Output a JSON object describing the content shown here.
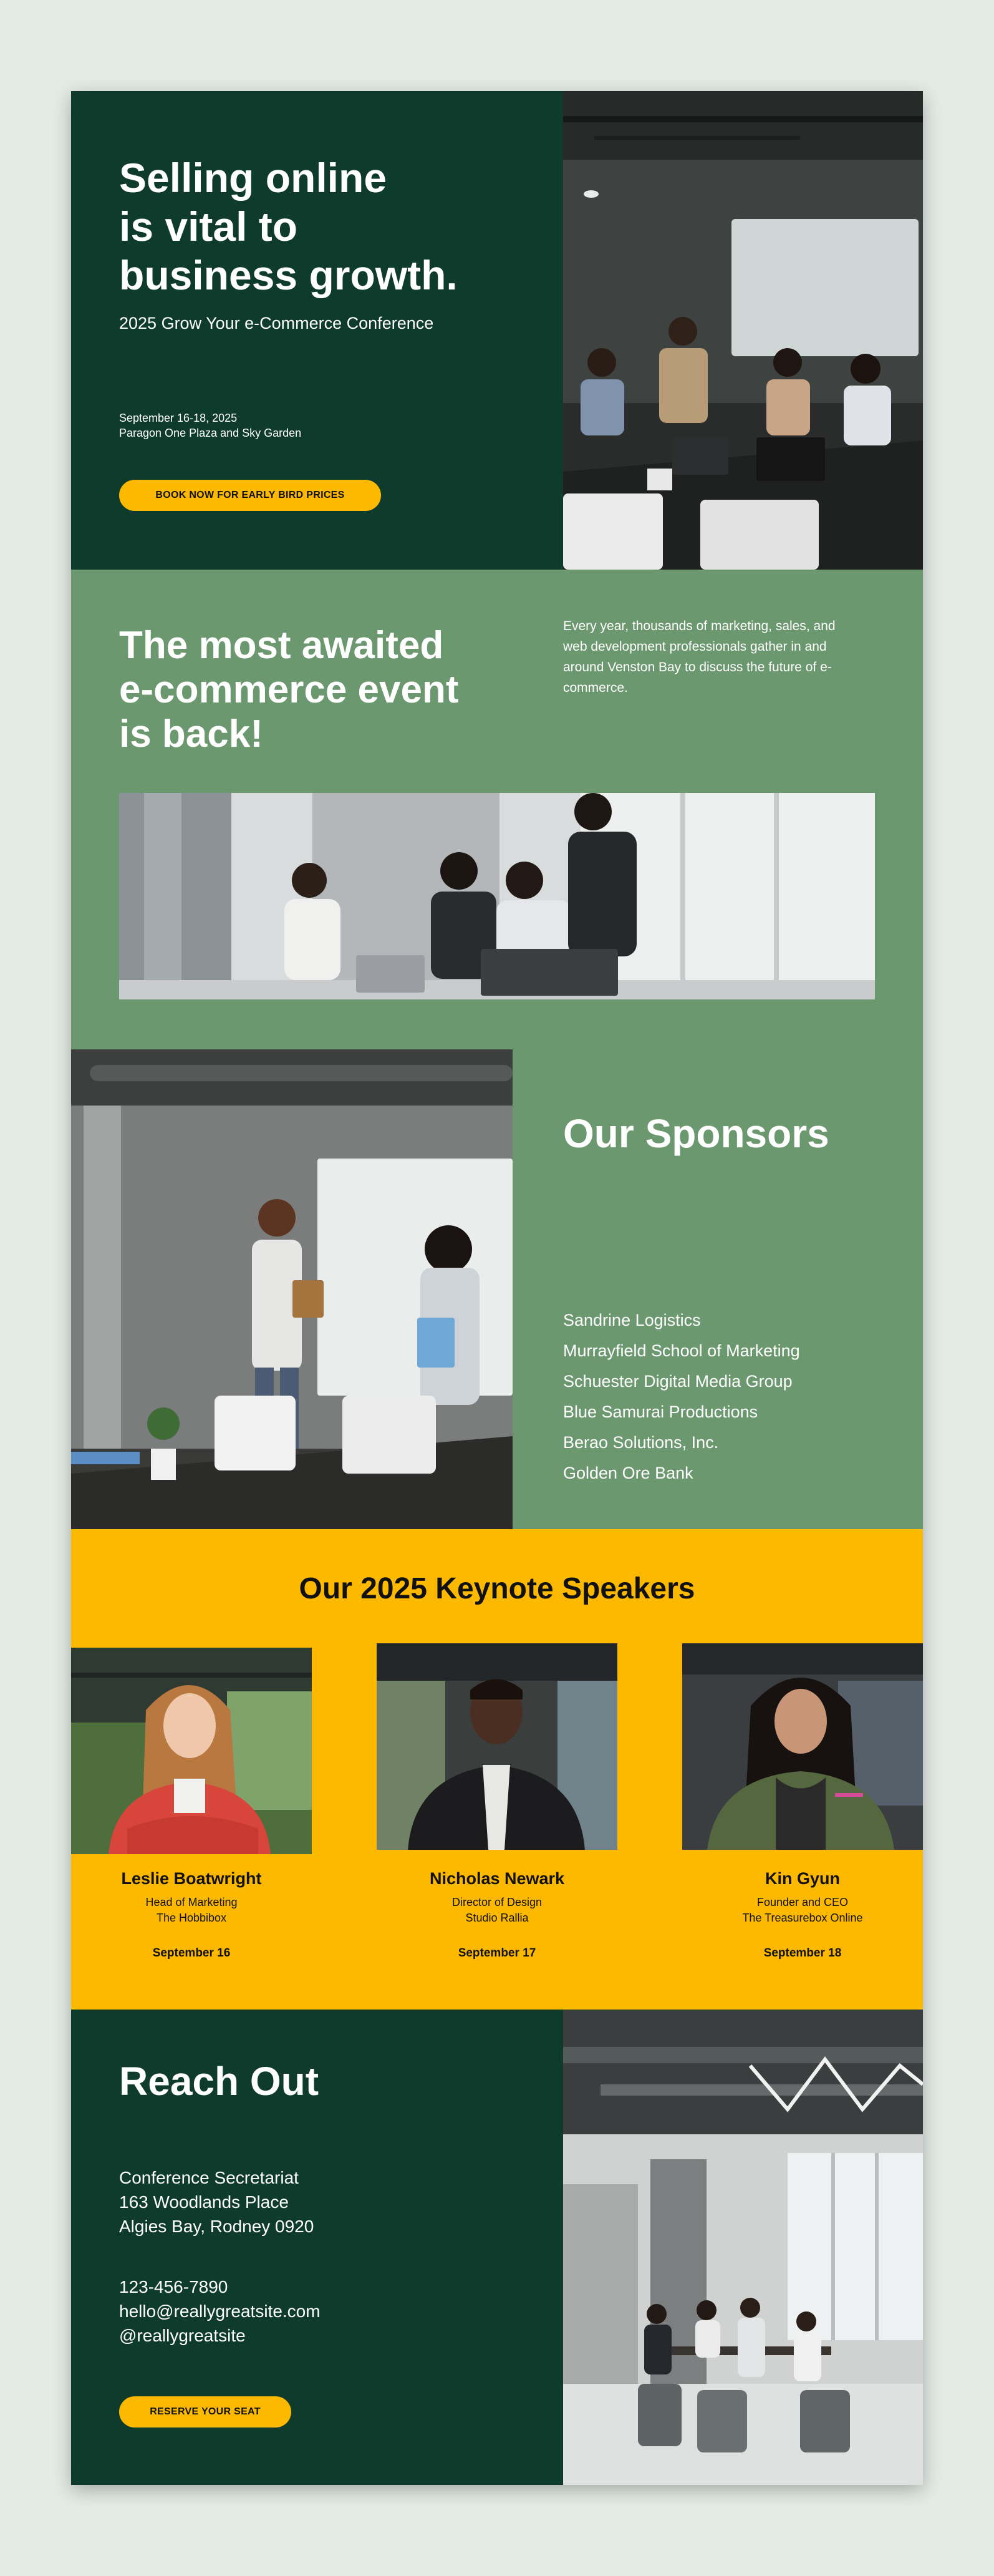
{
  "hero": {
    "title_lines": [
      "Selling online",
      "is vital to",
      "business growth."
    ],
    "subtitle": "2025 Grow Your e-Commerce Conference",
    "date": "September 16-18, 2025",
    "venue": "Paragon One Plaza and Sky Garden",
    "cta_label": "BOOK NOW FOR EARLY BIRD PRICES"
  },
  "event": {
    "title_lines": [
      "The most awaited",
      "e-commerce event",
      "is back!"
    ],
    "description": "Every year, thousands of marketing, sales, and web development professionals gather in and around Venston Bay to discuss the future of e-commerce."
  },
  "sponsors": {
    "title": "Our Sponsors",
    "items": [
      "Sandrine Logistics",
      "Murrayfield School of Marketing",
      "Schuester Digital Media Group",
      "Blue Samurai Productions",
      "Berao Solutions, Inc.",
      "Golden Ore Bank"
    ]
  },
  "speakers": {
    "title": "Our 2025 Keynote Speakers",
    "items": [
      {
        "name": "Leslie Boatwright",
        "role": "Head of Marketing",
        "company": "The Hobbibox",
        "date": "September 16"
      },
      {
        "name": "Nicholas Newark",
        "role": "Director of Design",
        "company": "Studio Rallia",
        "date": "September 17"
      },
      {
        "name": "Kin Gyun",
        "role": "Founder and CEO",
        "company": "The Treasurebox Online",
        "date": "September 18"
      }
    ]
  },
  "reach": {
    "title": "Reach Out",
    "address_lines": [
      "Conference Secretariat",
      "163 Woodlands Place",
      "Algies Bay, Rodney 0920"
    ],
    "phone": "123-456-7890",
    "email": "hello@reallygreatsite.com",
    "handle": "@reallygreatsite",
    "cta_label": "RESERVE YOUR SEAT"
  },
  "colors": {
    "dark_green": "#0f3b2c",
    "sage_green": "#6c9870",
    "yellow": "#fdb900"
  }
}
